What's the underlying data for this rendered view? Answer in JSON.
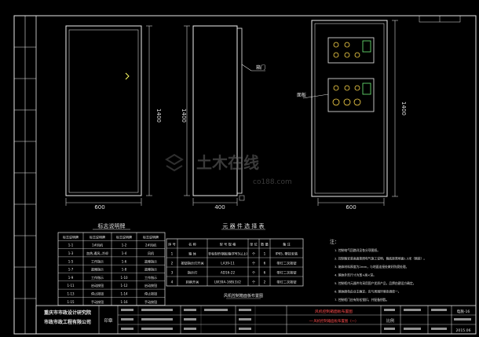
{
  "front_view": {
    "width_label": "600",
    "height_label": "1400"
  },
  "side_view": {
    "depth_label": "400",
    "height_label": "1400",
    "callout": "箱门"
  },
  "panel_view": {
    "width_label": "600",
    "height_label": "1400",
    "callout": "面板"
  },
  "legend_table": {
    "title": "标志说明牌",
    "headers": [
      "标志说明牌",
      "标志说明牌",
      "标志说明牌",
      "标志说明牌"
    ],
    "rows": [
      [
        "1-1",
        "1#风机",
        "1-2",
        "2#风机"
      ],
      [
        "1-3",
        "加热,通风,,冷却",
        "1-4",
        "风机"
      ],
      [
        "1-5",
        "工作指示",
        "1-6",
        "故障指示"
      ],
      [
        "1-7",
        "故障指示",
        "1-8",
        "故障指示"
      ],
      [
        "1-9",
        "工作指示",
        "1-10",
        "工作指示"
      ],
      [
        "1-11",
        "启动按钮",
        "1-12",
        "启动按钮"
      ],
      [
        "1-13",
        "停止按钮",
        "1-14",
        "停止按钮"
      ],
      [
        "1-15",
        "手动按钮",
        "1-16",
        "手动按钮"
      ]
    ]
  },
  "parts_table": {
    "title": "元 器 件 选 择 表",
    "headers": [
      "序 号",
      "名 称",
      "型 号 规 格",
      "单 位",
      "数 量",
      "备 注"
    ],
    "rows": [
      [
        "1",
        "箱 体",
        "非标制作钢板箱(IP65以上)",
        "个",
        "1",
        "IP65, 壁挂安装"
      ],
      [
        "2",
        "按钮指示灯开关",
        "LA39-11",
        "个",
        "6",
        "带灯二次按钮"
      ],
      [
        "3",
        "指示灯",
        "AD16-22",
        "个",
        "6",
        "带灯二次按钮"
      ],
      [
        "4",
        "转换开关",
        "LW39A-16B(3)/2",
        "个",
        "2",
        "带灯二次按钮"
      ]
    ],
    "caption": "风机控制箱面板布置图"
  },
  "notes": {
    "heading": "注：",
    "lines": [
      "1. 控制电气回路详见各分项图纸。",
      "2. 控制箱安装高度按照电气施工说明，箱底距离地面1.5米（暗装）。",
      "3. 箱体材料厚度为2mm，与地面连接处做好防腐处理。",
      "4. 箱体外形尺寸为宽×高×深。",
      "5. 控制柜内元器件均采用国产优质产品，品牌由建设方确定。",
      "6. 箱体颜色由业主确定，应与周围环境协调统一。",
      "7. 控制柜门应有防松锁扣，并配备钥匙。"
    ]
  },
  "title_block": {
    "company": "重庆市市政设计研究院",
    "company_sub": "市政市政工程有限公司",
    "company_stamp": "印章",
    "project_code": "风机控制箱面板布置图",
    "drawing_name": "一·风机控制箱面板布置图（一）",
    "scale": "比例",
    "date": "2015.06",
    "sheet": "电施-16"
  },
  "watermark": {
    "main": "土木在线",
    "sub": "co188.com"
  }
}
